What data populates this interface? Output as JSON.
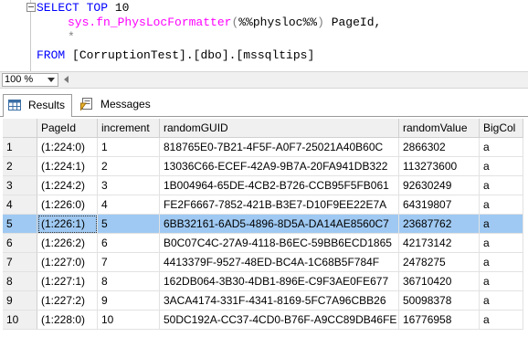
{
  "editor": {
    "line1_kw": "SELECT TOP",
    "line1_num": " 10",
    "line2_fn": "sys.fn_PhysLocFormatter",
    "line2_open": "(",
    "line2_arg": "%%physloc%%",
    "line2_close": ")",
    "line2_alias": " PageId,",
    "line3": "*",
    "line4_kw": "FROM",
    "line4_obj": " [CorruptionTest].[dbo].[mssqltips]"
  },
  "zoom": {
    "value": "100 %"
  },
  "tabs": {
    "results": "Results",
    "messages": "Messages"
  },
  "grid": {
    "columns": [
      "PageId",
      "increment",
      "randomGUID",
      "randomValue",
      "BigCol"
    ],
    "rows": [
      {
        "n": "1",
        "cells": [
          "(1:224:0)",
          "1",
          "818765E0-7B21-4F5F-A0F7-25021A40B60C",
          "2866302",
          "a"
        ]
      },
      {
        "n": "2",
        "cells": [
          "(1:224:1)",
          "2",
          "13036C66-ECEF-42A9-9B7A-20FA941DB322",
          "113273600",
          "a"
        ]
      },
      {
        "n": "3",
        "cells": [
          "(1:224:2)",
          "3",
          "1B004964-65DE-4CB2-B726-CCB95F5FB061",
          "92630249",
          "a"
        ]
      },
      {
        "n": "4",
        "cells": [
          "(1:226:0)",
          "4",
          "FE2F6667-7852-421B-B3E7-D10F9EE22E7A",
          "64319807",
          "a"
        ]
      },
      {
        "n": "5",
        "cells": [
          "(1:226:1)",
          "5",
          "6BB32161-6AD5-4896-8D5A-DA14AE8560C7",
          "23687762",
          "a"
        ]
      },
      {
        "n": "6",
        "cells": [
          "(1:226:2)",
          "6",
          "B0C07C4C-27A9-4118-B6EC-59BB6ECD1865",
          "42173142",
          "a"
        ]
      },
      {
        "n": "7",
        "cells": [
          "(1:227:0)",
          "7",
          "4413379F-9527-48ED-BC4A-1C68B5F784F",
          "2478275",
          "a"
        ]
      },
      {
        "n": "8",
        "cells": [
          "(1:227:1)",
          "8",
          "162DB064-3B30-4DB1-896E-C9F3AE0FE677",
          "36710420",
          "a"
        ]
      },
      {
        "n": "9",
        "cells": [
          "(1:227:2)",
          "9",
          "3ACA4174-331F-4341-8169-5FC7A96CBB26",
          "50098378",
          "a"
        ]
      },
      {
        "n": "10",
        "cells": [
          "(1:228:0)",
          "10",
          "50DC192A-CC37-4CD0-B76F-A9CC89DB46FE",
          "16776958",
          "a"
        ]
      }
    ],
    "selected_row": "5"
  },
  "colors": {
    "selection": "#9fc9f2",
    "keyword": "#0000ff",
    "function": "#ff00ff"
  }
}
